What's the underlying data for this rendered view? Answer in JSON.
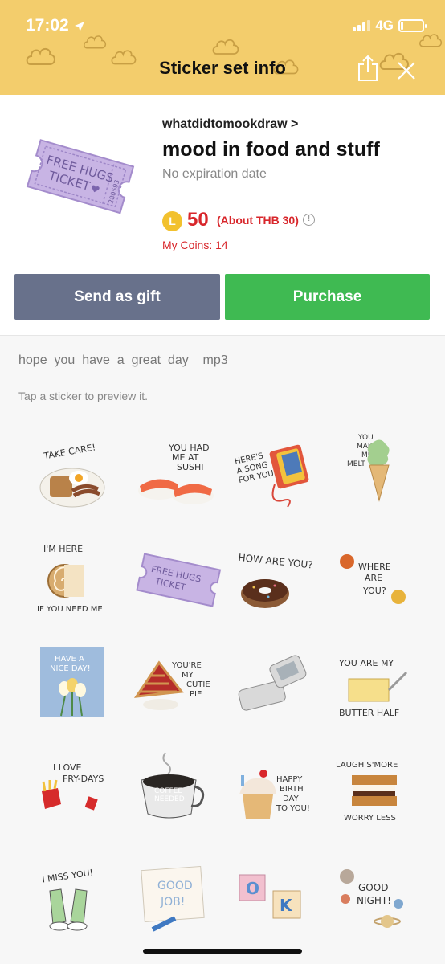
{
  "status_bar": {
    "time": "17:02",
    "network": "4G"
  },
  "header": {
    "title": "Sticker set info"
  },
  "product": {
    "author": "whatdidtomookdraw >",
    "title": "mood in food and stuff",
    "expiration": "No expiration date",
    "coin_symbol": "L",
    "price": "50",
    "price_approx": "(About THB 30)",
    "my_coins": "My Coins: 14",
    "ticket_text": [
      "FREE HUGS",
      "TICKET",
      "280593"
    ]
  },
  "actions": {
    "gift_label": "Send as gift",
    "purchase_label": "Purchase"
  },
  "list": {
    "series_name": "hope_you_have_a_great_day__mp3",
    "hint": "Tap a sticker to preview it."
  },
  "stickers": [
    {
      "name": "take-care-breakfast",
      "lines": [
        "TAKE CARE!"
      ]
    },
    {
      "name": "sushi",
      "lines": [
        "YOU HAD",
        "ME AT",
        "SUSHI"
      ]
    },
    {
      "name": "cassette-song",
      "lines": [
        "HERE'S",
        "A SONG",
        "FOR YOU"
      ]
    },
    {
      "name": "ice-cream-melt",
      "lines": [
        "YOU",
        "MAKE",
        "ME",
        "MELT"
      ]
    },
    {
      "name": "roll-cake",
      "lines": [
        "I'M HERE",
        "IF YOU NEED ME"
      ]
    },
    {
      "name": "free-hugs-ticket",
      "lines": [
        "FREE HUGS",
        "TICKET"
      ]
    },
    {
      "name": "donut",
      "lines": [
        "HOW ARE YOU?"
      ]
    },
    {
      "name": "where-are-you",
      "lines": [
        "WHERE",
        "ARE",
        "YOU?"
      ]
    },
    {
      "name": "have-a-nice-day-card",
      "lines": [
        "HAVE A",
        "NICE DAY!"
      ]
    },
    {
      "name": "cherry-pie",
      "lines": [
        "YOU'RE",
        "MY",
        "CUTIE",
        "PIE"
      ]
    },
    {
      "name": "flip-phone",
      "lines": []
    },
    {
      "name": "butter-half",
      "lines": [
        "YOU ARE MY",
        "BUTTER HALF"
      ]
    },
    {
      "name": "fry-days",
      "lines": [
        "I LOVE",
        "FRY-DAYS"
      ]
    },
    {
      "name": "coffee-cup",
      "lines": [
        "COFFEE",
        "NEEDED"
      ]
    },
    {
      "name": "birthday-cupcake",
      "lines": [
        "HAPPY",
        "BIRTH",
        "DAY",
        "TO YOU!"
      ]
    },
    {
      "name": "smores",
      "lines": [
        "LAUGH S'MORE",
        "WORRY LESS"
      ]
    },
    {
      "name": "miss-you-shoes",
      "lines": [
        "I MISS YOU!"
      ]
    },
    {
      "name": "good-job",
      "lines": [
        "GOOD",
        "JOB!"
      ]
    },
    {
      "name": "ok-blocks",
      "lines": [
        "O",
        "K"
      ]
    },
    {
      "name": "good-night-planets",
      "lines": [
        "GOOD",
        "NIGHT!"
      ]
    }
  ],
  "colors": {
    "header": "#f3cd6c",
    "gift_button": "#68718b",
    "purchase_button": "#3fba52",
    "price": "#d8262b",
    "ticket": "#c8b4e4"
  }
}
